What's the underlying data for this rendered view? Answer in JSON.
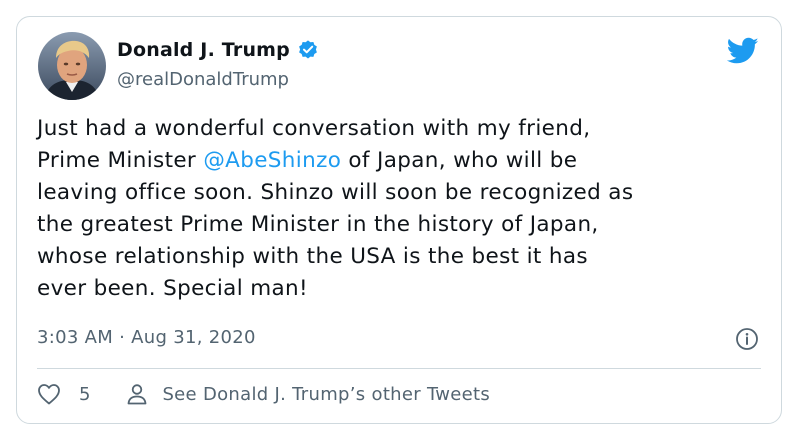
{
  "author": {
    "display_name": "Donald J. Trump",
    "handle": "@realDonaldTrump",
    "verified": true,
    "avatar_icon": "profile-photo"
  },
  "brand": {
    "logo_icon": "twitter-bird-icon",
    "accent_color": "#1d9bf0"
  },
  "tweet": {
    "lines": [
      "Just had a wonderful conversation with my friend,",
      "Prime Minister ",
      "@AbeShinzo",
      " of Japan, who will be",
      "leaving office soon. Shinzo will soon be recognized as",
      "the greatest Prime Minister in the history of Japan,",
      "whose relationship with the USA is the best it has",
      "ever been. Special man!"
    ]
  },
  "meta": {
    "time": "3:03 AM",
    "separator": "·",
    "date": "Aug 31, 2020",
    "info_icon": "info-icon"
  },
  "actions": {
    "like_icon": "heart-icon",
    "like_count": "5",
    "profile_icon": "person-icon",
    "see_tweets_label": "See Donald J. Trump’s other Tweets"
  }
}
